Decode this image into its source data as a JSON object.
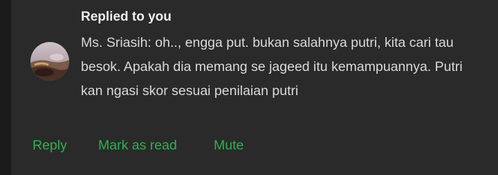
{
  "notification": {
    "title": "Replied to you",
    "message": "Ms. Sriasih: oh.., engga put. bukan salahnya putri, kita cari tau besok. Apakah dia memang se jageed itu kemampuannya. Putri kan ngasi skor sesuai penilaian putri"
  },
  "actions": {
    "reply_label": "Reply",
    "mark_as_read_label": "Mark as read",
    "mute_label": "Mute"
  },
  "colors": {
    "background": "#1b1b1b",
    "card": "#2a2a2a",
    "title": "#eeeeee",
    "message": "#dadada",
    "action": "#2bb34e"
  },
  "icons": {
    "avatar": "contact-avatar-photo"
  }
}
